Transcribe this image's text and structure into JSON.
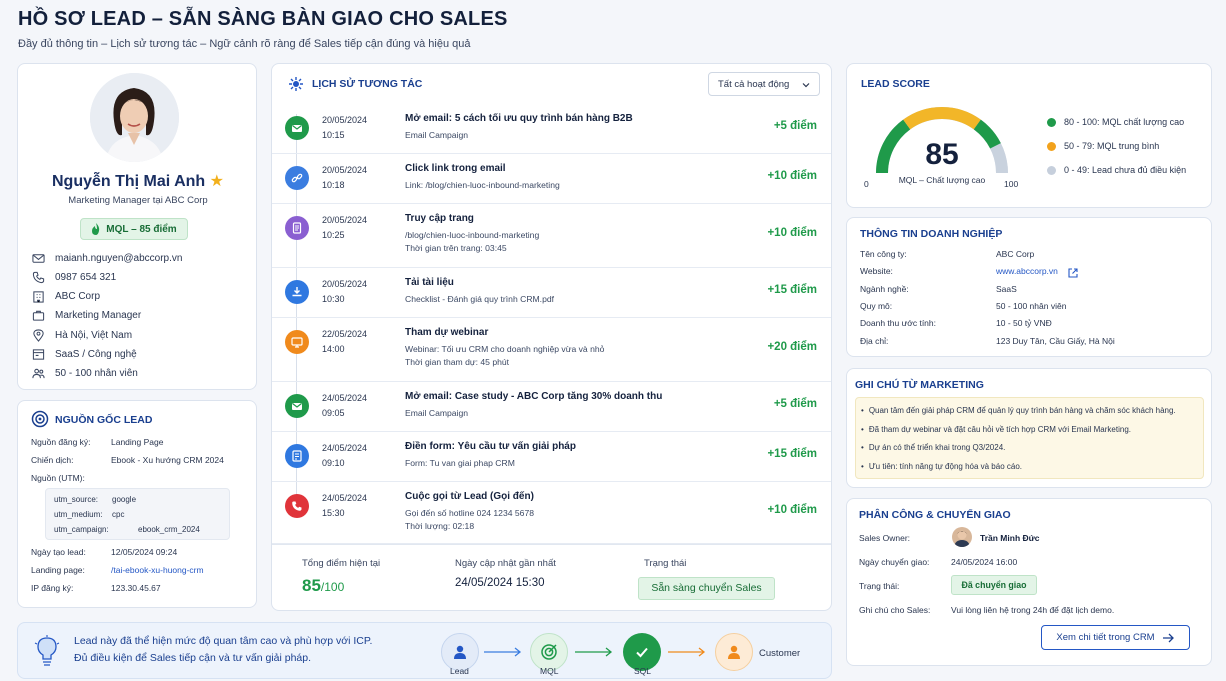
{
  "header": {
    "title": "HỒ SƠ LEAD – SẴN SÀNG BÀN GIAO CHO SALES",
    "subtitle": "Đầy đủ thông tin – Lịch sử tương tác – Ngữ cảnh rõ ràng để Sales tiếp cận đúng và hiệu quả"
  },
  "profile": {
    "name": "Nguyễn Thị Mai Anh",
    "role": "Marketing Manager tại ABC Corp",
    "badge": "MQL – 85 điểm",
    "email": "maianh.nguyen@abccorp.vn",
    "phone": "0987 654 321",
    "company": "ABC Corp",
    "position": "Marketing Manager",
    "location": "Hà Nội, Việt Nam",
    "industry": "SaaS / Công nghệ",
    "size": "50 - 100 nhân viên"
  },
  "source": {
    "title": "NGUỒN GỐC LEAD",
    "register_label": "Nguồn đăng ký:",
    "register_value": "Landing Page",
    "campaign_label": "Chiến dịch:",
    "campaign_value": "Ebook - Xu hướng CRM 2024",
    "utm_label": "Nguồn (UTM):",
    "utm": [
      {
        "k": "utm_source:",
        "v": "google"
      },
      {
        "k": "utm_medium:",
        "v": "cpc"
      },
      {
        "k": "utm_campaign:",
        "v": "ebook_crm_2024"
      }
    ],
    "created_label": "Ngày tạo lead:",
    "created_value": "12/05/2024 09:24",
    "landing_label": "Landing page:",
    "landing_value": "/tai-ebook-xu-huong-crm",
    "ip_label": "IP đăng ký:",
    "ip_value": "123.30.45.67"
  },
  "history": {
    "title": "LỊCH SỬ TƯƠNG TÁC",
    "filter": "Tất cả hoạt động",
    "items": [
      {
        "date": "20/05/2024",
        "time": "10:15",
        "title": "Mở email: 5 cách tối ưu quy trình bán hàng B2B",
        "sub1": "Email Campaign",
        "sub2": "",
        "points": "+5 điểm",
        "color": "#1f9a4a",
        "icon": "mail-icon"
      },
      {
        "date": "20/05/2024",
        "time": "10:18",
        "title": "Click link trong email",
        "sub1": "Link: /blog/chien-luoc-inbound-marketing",
        "sub2": "",
        "points": "+10 điểm",
        "color": "#3b7de0",
        "icon": "link-icon"
      },
      {
        "date": "20/05/2024",
        "time": "10:25",
        "title": "Truy cập trang",
        "sub1": "/blog/chien-luoc-inbound-marketing",
        "sub2": "Thời gian trên trang: 03:45",
        "points": "+10 điểm",
        "color": "#8a5fd1",
        "icon": "page-icon"
      },
      {
        "date": "20/05/2024",
        "time": "10:30",
        "title": "Tải tài liệu",
        "sub1": "Checklist - Đánh giá quy trình CRM.pdf",
        "sub2": "",
        "points": "+15 điểm",
        "color": "#2f78e0",
        "icon": "download-icon"
      },
      {
        "date": "22/05/2024",
        "time": "14:00",
        "title": "Tham dự webinar",
        "sub1": "Webinar: Tối ưu CRM cho doanh nghiệp vừa và nhỏ",
        "sub2": "Thời gian tham dự: 45 phút",
        "points": "+20 điểm",
        "color": "#f08a1c",
        "icon": "webinar-icon"
      },
      {
        "date": "24/05/2024",
        "time": "09:05",
        "title": "Mở email: Case study - ABC Corp tăng 30% doanh thu",
        "sub1": "Email Campaign",
        "sub2": "",
        "points": "+5 điểm",
        "color": "#1f9a4a",
        "icon": "mail-icon"
      },
      {
        "date": "24/05/2024",
        "time": "09:10",
        "title": "Điền form: Yêu cầu tư vấn giải pháp",
        "sub1": "Form: Tu van giai phap CRM",
        "sub2": "",
        "points": "+15 điểm",
        "color": "#2f78e0",
        "icon": "form-icon"
      },
      {
        "date": "24/05/2024",
        "time": "15:30",
        "title": "Cuộc gọi từ Lead (Gọi đến)",
        "sub1": "Gọi đến số hotline 024 1234 5678",
        "sub2": "Thời lượng: 02:18",
        "points": "+10 điểm",
        "color": "#e0343a",
        "icon": "phone-icon"
      }
    ],
    "total_label": "Tổng điểm hiện tại",
    "total_value": "85",
    "total_max": "/100",
    "updated_label": "Ngày cập nhật gần nhất",
    "updated_value": "24/05/2024 15:30",
    "status_label": "Trạng thái",
    "status_value": "Sẵn sàng chuyển Sales"
  },
  "score": {
    "title": "LEAD SCORE",
    "value": "85",
    "fraction": 0.85,
    "caption": "MQL – Chất lượng cao",
    "min": "0",
    "max": "100",
    "legend": [
      {
        "label": "80 - 100: MQL chất lượng cao",
        "color": "#1f9a4a"
      },
      {
        "label": "50 - 79: MQL trung bình",
        "color": "#f2a21c"
      },
      {
        "label": "0 - 49: Lead chưa đủ điều kiện",
        "color": "#c6cfdc"
      }
    ]
  },
  "enterprise": {
    "title": "THÔNG TIN DOANH NGHIỆP",
    "rows": [
      {
        "k": "Tên công ty:",
        "v": "ABC Corp"
      },
      {
        "k": "Website:",
        "v": "www.abccorp.vn"
      },
      {
        "k": "Ngành nghề:",
        "v": "SaaS"
      },
      {
        "k": "Quy mô:",
        "v": "50 - 100 nhân viên"
      },
      {
        "k": "Doanh thu ước tính:",
        "v": "10 - 50 tỷ VNĐ"
      },
      {
        "k": "Địa chỉ:",
        "v": "123 Duy Tân, Cầu Giấy, Hà Nội"
      }
    ]
  },
  "notes": {
    "title": "GHI CHÚ TỪ MARKETING",
    "items": [
      "Quan tâm đến giải pháp CRM để quản lý quy trình bán hàng và chăm sóc khách hàng.",
      "Đã tham dự webinar và đặt câu hỏi về tích hợp CRM với Email Marketing.",
      "Dự án có thể triển khai trong Q3/2024.",
      "Ưu tiên: tính năng tự động hóa và báo cáo."
    ]
  },
  "handover": {
    "title": "PHÂN CÔNG & CHUYỂN GIAO",
    "owner_label": "Sales Owner:",
    "owner_value": "Trần Minh Đức",
    "date_label": "Ngày chuyển giao:",
    "date_value": "24/05/2024 16:00",
    "status_label": "Trạng thái:",
    "status_value": "Đã chuyển giao",
    "note_label": "Ghi chú cho Sales:",
    "note_value": "Vui lòng liên hệ trong 24h để đặt lịch demo.",
    "button": "Xem chi tiết trong CRM"
  },
  "insight": {
    "line1": "Lead này đã thể hiện mức độ quan tâm cao và phù hợp với ICP.",
    "line2": "Đủ điều kiện để Sales tiếp cận và tư vấn giải pháp.",
    "stages": [
      "Lead",
      "MQL",
      "SQL",
      "Customer"
    ]
  }
}
